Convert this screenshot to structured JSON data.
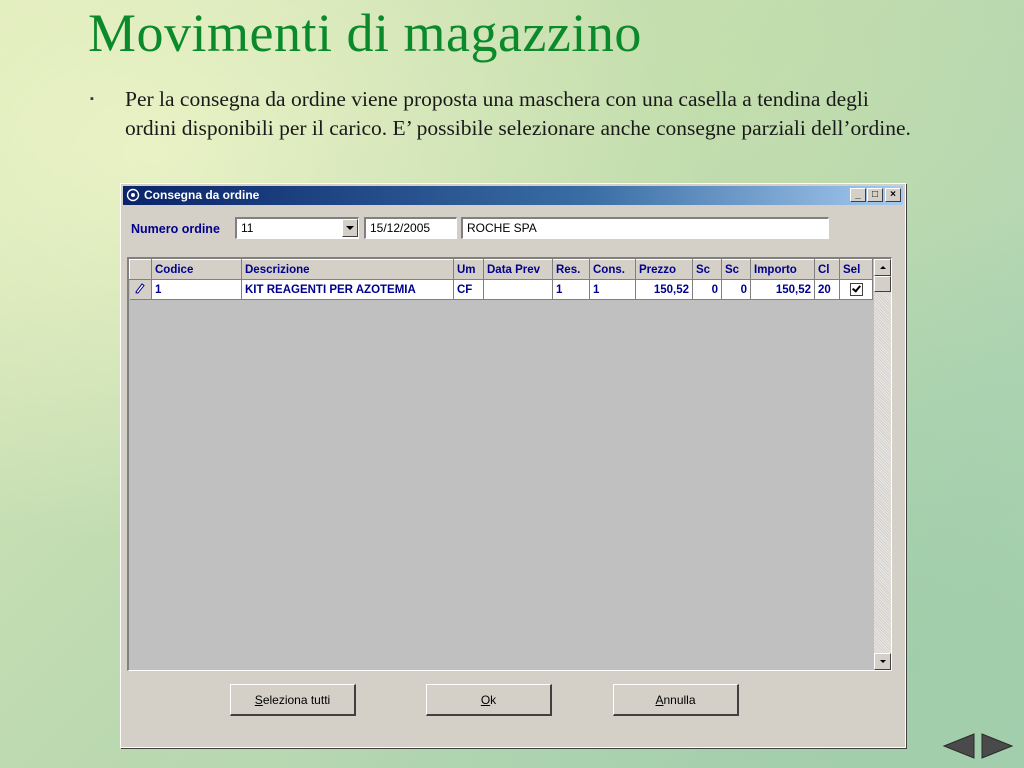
{
  "slide": {
    "title": "Movimenti di magazzino",
    "bullet_text": "Per la consegna da ordine viene proposta una maschera con una casella a tendina degli ordini disponibili per il carico. E’ possibile selezionare anche consegne parziali dell’ordine.",
    "bullet_glyph": "▪"
  },
  "window": {
    "title": "Consegna da ordine",
    "min_glyph": "_",
    "max_glyph": "□",
    "close_glyph": "×"
  },
  "form": {
    "order_label": "Numero ordine",
    "order_number": "11",
    "order_date": "15/12/2005",
    "supplier": "ROCHE SPA"
  },
  "grid": {
    "columns": [
      "Codice",
      "Descrizione",
      "Um",
      "Data Prev",
      "Res.",
      "Cons.",
      "Prezzo",
      "Sc",
      "Sc",
      "Importo",
      "Cl",
      "Sel"
    ],
    "rows": [
      {
        "codice": "1",
        "descrizione": "KIT REAGENTI PER AZOTEMIA",
        "um": "CF",
        "data_prev": "",
        "res": "1",
        "cons": "1",
        "prezzo": "150,52",
        "sc1": "0",
        "sc2": "0",
        "importo": "150,52",
        "cl": "20",
        "sel": true
      }
    ]
  },
  "buttons": {
    "select_all_accel": "S",
    "select_all_rest": "eleziona tutti",
    "ok_accel": "O",
    "ok_rest": "k",
    "cancel_accel": "A",
    "cancel_rest": "nnulla"
  },
  "colors": {
    "title_green": "#0b8a2c",
    "header_text": "#00008b",
    "titlebar_start": "#0a246a",
    "window_face": "#d4d0c8"
  },
  "icons": [
    "app-icon",
    "pencil-icon",
    "checkbox-checked-icon",
    "prev-slide-icon",
    "next-slide-icon"
  ]
}
